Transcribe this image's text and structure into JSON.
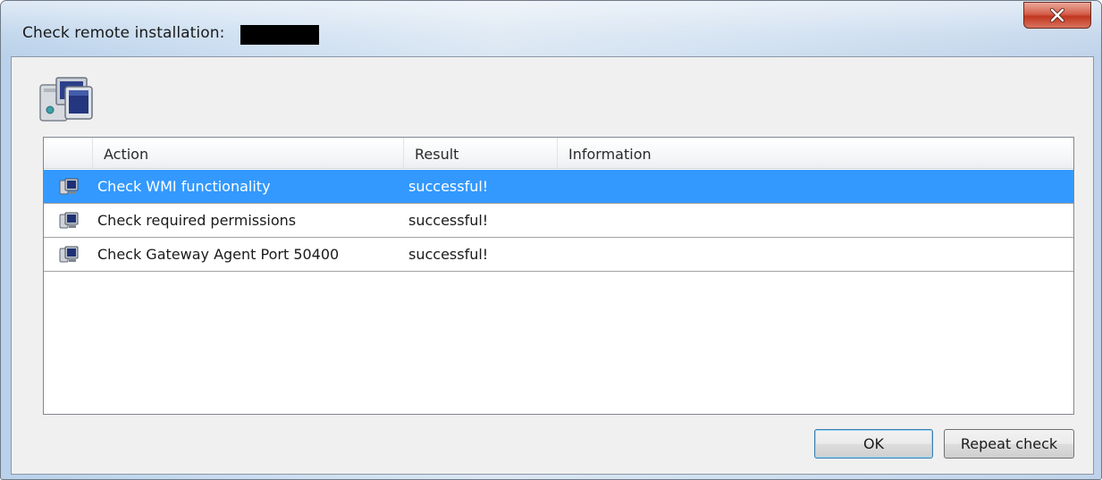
{
  "window": {
    "title": "Check remote installation:"
  },
  "list": {
    "columns": [
      "",
      "Action",
      "Result",
      "Information"
    ],
    "rows": [
      {
        "action": "Check WMI functionality",
        "result": "successful!",
        "information": "",
        "selected": true
      },
      {
        "action": "Check required permissions",
        "result": "successful!",
        "information": "",
        "selected": false
      },
      {
        "action": "Check Gateway Agent Port 50400",
        "result": "successful!",
        "information": "",
        "selected": false
      }
    ]
  },
  "buttons": {
    "ok": "OK",
    "repeat": "Repeat check"
  },
  "icons": {
    "header": "computers-icon",
    "row": "computer-icon",
    "close": "close-icon"
  },
  "colors": {
    "selection": "#3399ff",
    "close_button": "#c1361f"
  }
}
